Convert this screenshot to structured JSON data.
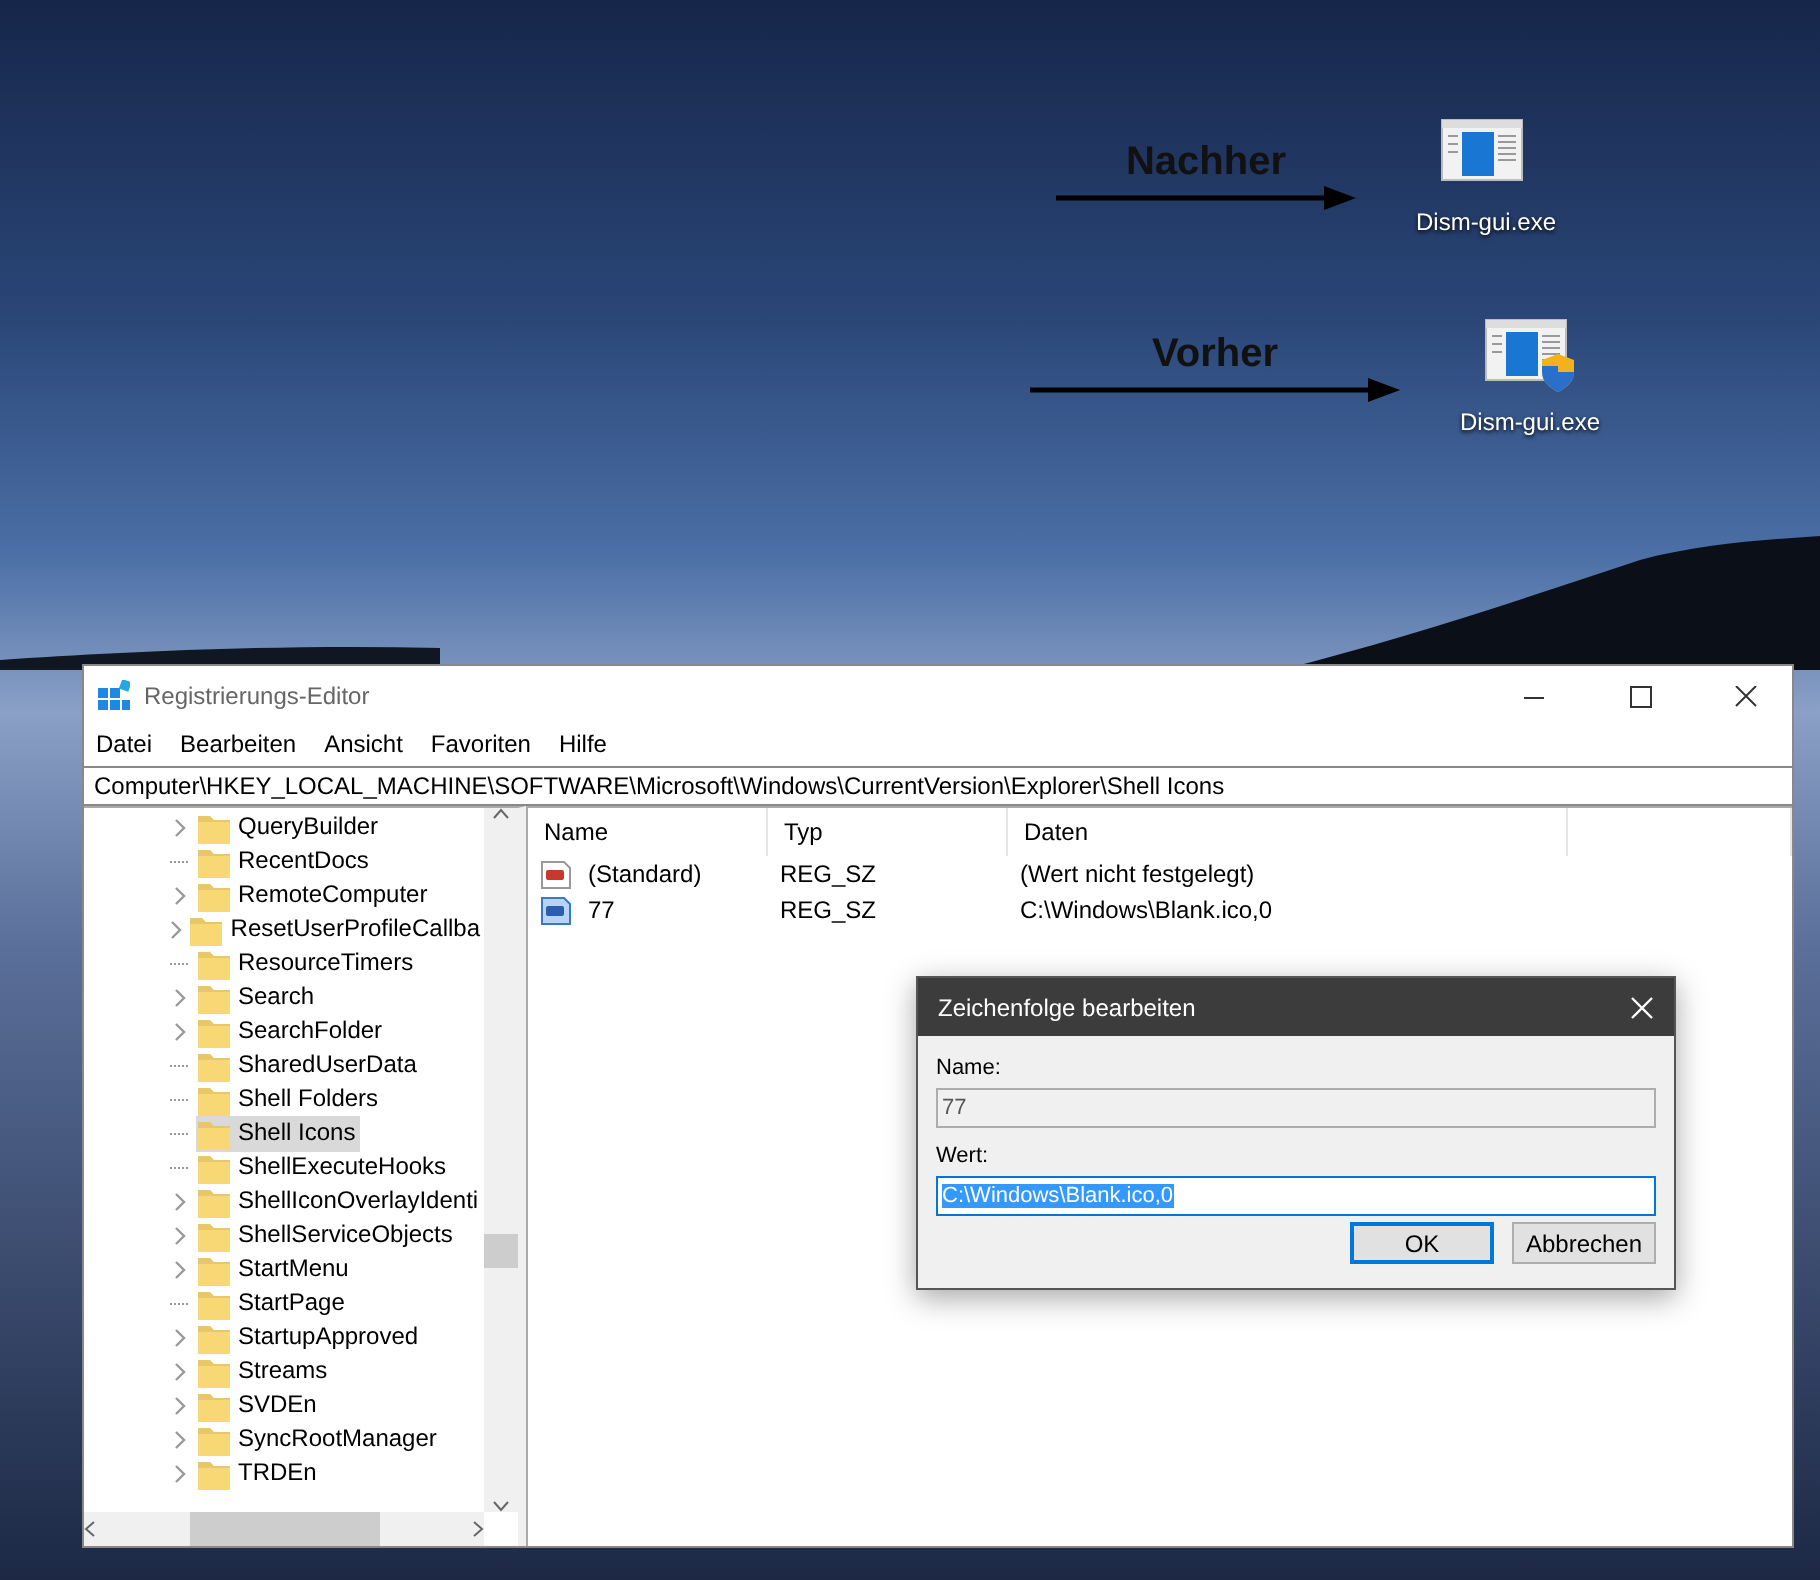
{
  "desktop": {
    "annotations": [
      {
        "label": "Nachher",
        "icon_label": "Dism-gui.exe",
        "shield": false
      },
      {
        "label": "Vorher",
        "icon_label": "Dism-gui.exe",
        "shield": true
      }
    ]
  },
  "window": {
    "title": "Registrierungs-Editor",
    "menu": [
      "Datei",
      "Bearbeiten",
      "Ansicht",
      "Favoriten",
      "Hilfe"
    ],
    "address": "Computer\\HKEY_LOCAL_MACHINE\\SOFTWARE\\Microsoft\\Windows\\CurrentVersion\\Explorer\\Shell Icons",
    "tree": {
      "items": [
        {
          "label": "QueryBuilder",
          "expandable": true,
          "selected": false
        },
        {
          "label": "RecentDocs",
          "expandable": false,
          "selected": false
        },
        {
          "label": "RemoteComputer",
          "expandable": true,
          "selected": false
        },
        {
          "label": "ResetUserProfileCallba",
          "expandable": true,
          "selected": false
        },
        {
          "label": "ResourceTimers",
          "expandable": false,
          "selected": false
        },
        {
          "label": "Search",
          "expandable": true,
          "selected": false
        },
        {
          "label": "SearchFolder",
          "expandable": true,
          "selected": false
        },
        {
          "label": "SharedUserData",
          "expandable": false,
          "selected": false
        },
        {
          "label": "Shell Folders",
          "expandable": false,
          "selected": false
        },
        {
          "label": "Shell Icons",
          "expandable": false,
          "selected": true
        },
        {
          "label": "ShellExecuteHooks",
          "expandable": false,
          "selected": false
        },
        {
          "label": "ShellIconOverlayIdenti",
          "expandable": true,
          "selected": false
        },
        {
          "label": "ShellServiceObjects",
          "expandable": true,
          "selected": false
        },
        {
          "label": "StartMenu",
          "expandable": true,
          "selected": false
        },
        {
          "label": "StartPage",
          "expandable": false,
          "selected": false
        },
        {
          "label": "StartupApproved",
          "expandable": true,
          "selected": false
        },
        {
          "label": "Streams",
          "expandable": true,
          "selected": false
        },
        {
          "label": "SVDEn",
          "expandable": true,
          "selected": false
        },
        {
          "label": "SyncRootManager",
          "expandable": true,
          "selected": false
        },
        {
          "label": "TRDEn",
          "expandable": true,
          "selected": false
        }
      ]
    },
    "table": {
      "columns": [
        "Name",
        "Typ",
        "Daten"
      ],
      "rows": [
        {
          "name": "(Standard)",
          "type": "REG_SZ",
          "data": "(Wert nicht festgelegt)",
          "selected": false
        },
        {
          "name": "77",
          "type": "REG_SZ",
          "data": "C:\\Windows\\Blank.ico,0",
          "selected": true
        }
      ]
    }
  },
  "dialog": {
    "title": "Zeichenfolge bearbeiten",
    "name_label": "Name:",
    "name_value": "77",
    "value_label": "Wert:",
    "value": "C:\\Windows\\Blank.ico,0",
    "buttons": [
      {
        "label": "OK",
        "default": true
      },
      {
        "label": "Abbrechen",
        "default": false
      }
    ]
  }
}
